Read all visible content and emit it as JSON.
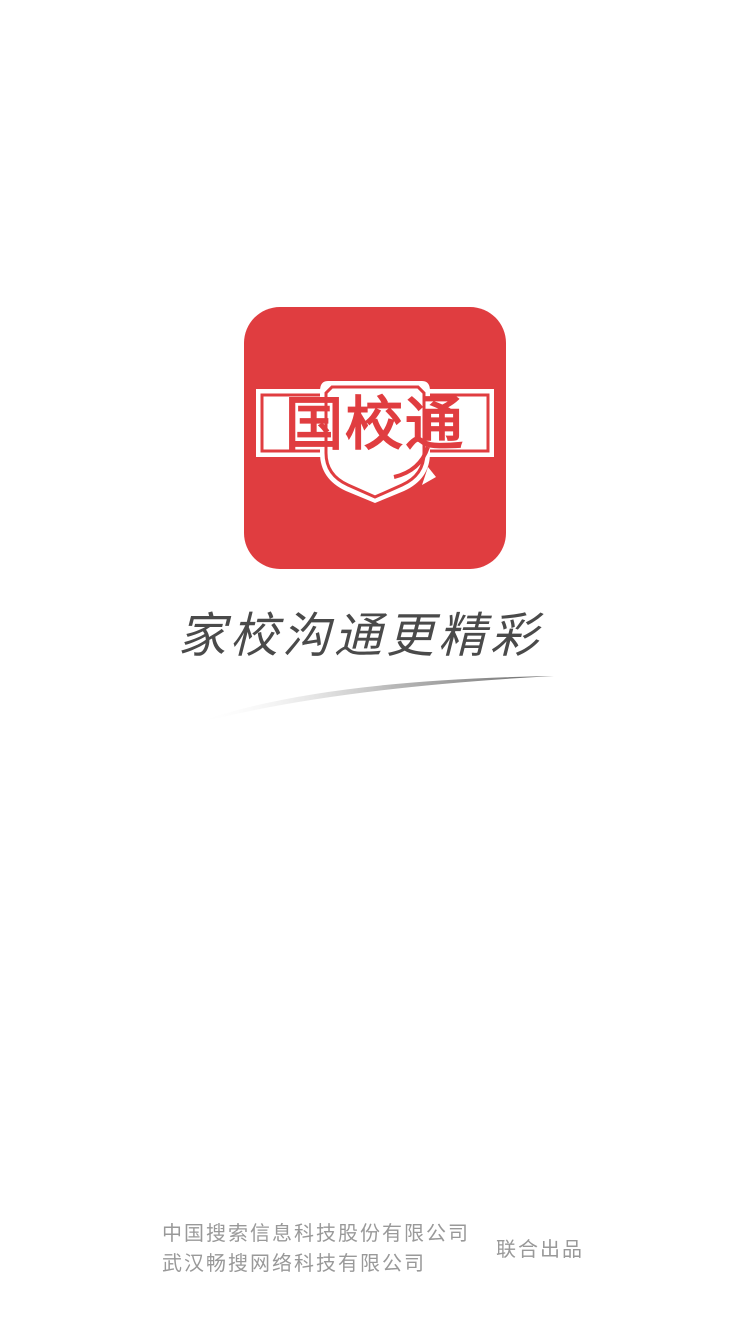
{
  "app": {
    "logo_text": "国校通",
    "brand_color": "#e03d40"
  },
  "splash": {
    "slogan": "家校沟通更精彩"
  },
  "footer": {
    "company_1": "中国搜索信息科技股份有限公司",
    "company_2": "武汉畅搜网络科技有限公司",
    "joint_label": "联合出品"
  }
}
